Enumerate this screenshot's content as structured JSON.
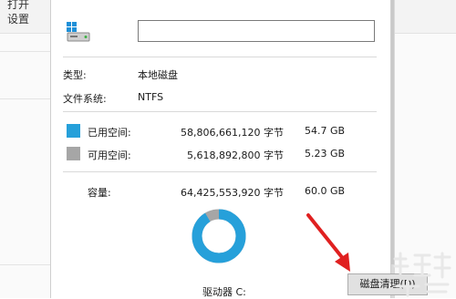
{
  "background_window": {
    "open_label": "打开",
    "settings_label": "设置"
  },
  "dialog": {
    "name_field_value": "",
    "type_label": "类型:",
    "type_value": "本地磁盘",
    "fs_label": "文件系统:",
    "fs_value": "NTFS",
    "used": {
      "label": "已用空间:",
      "bytes": "58,806,661,120 字节",
      "size": "54.7 GB",
      "color": "#26a0da"
    },
    "free": {
      "label": "可用空间:",
      "bytes": "5,618,892,800 字节",
      "size": "5.23 GB",
      "color": "#a6a6a6"
    },
    "capacity": {
      "label": "容量:",
      "bytes": "64,425,553,920 字节",
      "size": "60.0 GB"
    },
    "drive_label": "驱动器 C:",
    "cleanup_button": "磁盘清理(D)",
    "usage_fraction": 0.913
  },
  "icons": {
    "drive": "hard-drive-icon",
    "arrow": "red-arrow-annotation"
  }
}
